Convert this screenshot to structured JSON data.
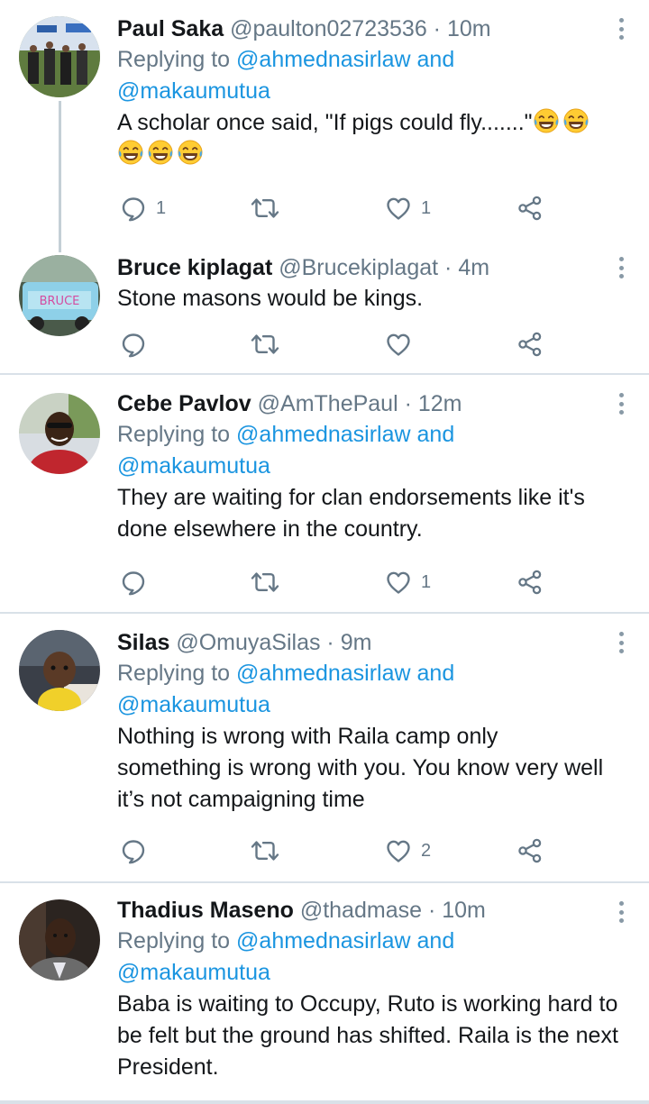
{
  "tweets": [
    {
      "name": "Paul Saka",
      "handle": "@paulton02723536",
      "dot": " · ",
      "time": "10m",
      "replying_prefix": "Replying to ",
      "mention1": "@ahmednasirlaw",
      "and": " and",
      "mention2": "@makaumutua",
      "text": "A scholar once said, \"If pigs could fly.......\"",
      "emojis": [
        "face-with-tears-of-joy",
        "face-with-tears-of-joy",
        "face-with-tears-of-joy",
        "face-with-tears-of-joy",
        "face-with-tears-of-joy"
      ],
      "reply_count": "1",
      "retweet_count": "",
      "like_count": "1"
    },
    {
      "name": "Bruce kiplagat",
      "handle": "@Brucekiplagat",
      "dot": " · ",
      "time": "4m",
      "text": "Stone masons would be kings.",
      "reply_count": "",
      "retweet_count": "",
      "like_count": ""
    },
    {
      "name": "Cebe Pavlov",
      "handle": "@AmThePaul",
      "dot": " · ",
      "time": "12m",
      "replying_prefix": "Replying to ",
      "mention1": "@ahmednasirlaw",
      "and": " and",
      "mention2": "@makaumutua",
      "text": "They are waiting for clan endorsements like it's done elsewhere in the country.",
      "reply_count": "",
      "retweet_count": "",
      "like_count": "1"
    },
    {
      "name": "Silas",
      "handle": "@OmuyaSilas",
      "dot": " · ",
      "time": "9m",
      "replying_prefix": "Replying to ",
      "mention1": "@ahmednasirlaw",
      "and": " and",
      "mention2": "@makaumutua",
      "text": "Nothing is wrong with Raila camp only something is wrong with you. You know very well it’s not campaigning time",
      "reply_count": "",
      "retweet_count": "",
      "like_count": "2"
    },
    {
      "name": "Thadius Maseno",
      "handle": "@thadmase",
      "dot": " · ",
      "time": "10m",
      "replying_prefix": "Replying to ",
      "mention1": "@ahmednasirlaw",
      "and": " and",
      "mention2": "@makaumutua",
      "text": "Baba is waiting to Occupy, Ruto is working hard to be felt but the ground has shifted. Raila is the next President."
    }
  ],
  "colors": {
    "text": "#14171a",
    "secondary": "#657786",
    "link": "#1b95e0",
    "icon": "#657786",
    "divider": "#d9e1e8",
    "thread_line": "#c4cfd6"
  },
  "icons": [
    "reply-icon",
    "retweet-icon",
    "like-icon",
    "share-icon",
    "more-options-icon"
  ]
}
